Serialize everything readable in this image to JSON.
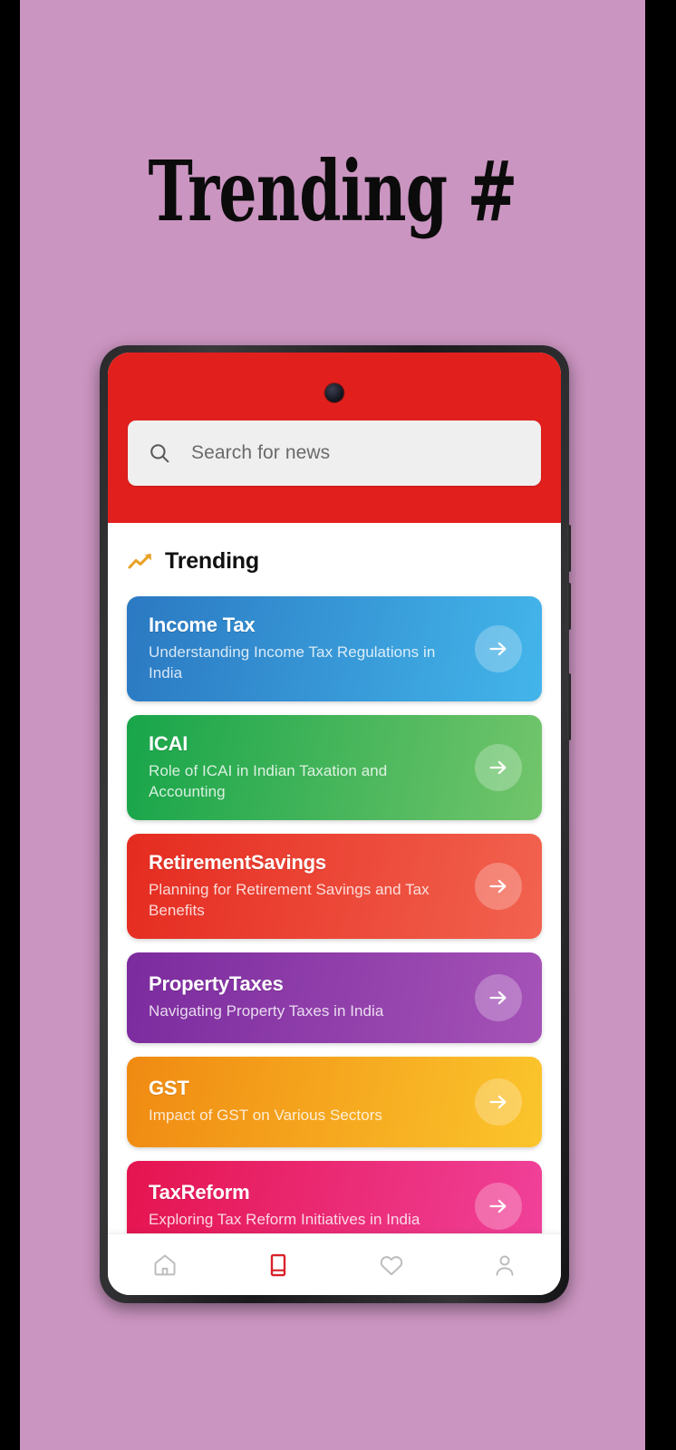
{
  "poster": {
    "title": "Trending #",
    "background_color": "#cb95c1",
    "letterbox_color": "#000000"
  },
  "app": {
    "header": {
      "background_color": "#e1201d",
      "search": {
        "placeholder": "Search for news",
        "icon": "search-icon",
        "value": ""
      },
      "camera": "camera-punch-hole"
    },
    "section": {
      "icon": "trending-up-icon",
      "title": "Trending"
    },
    "cards": [
      {
        "title": "Income Tax",
        "subtitle": "Understanding Income Tax Regulations in India",
        "color_start": "#2b79c2",
        "color_end": "#43b5ea",
        "arrow_icon": "arrow-right-icon"
      },
      {
        "title": "ICAI",
        "subtitle": "Role of ICAI in Indian Taxation and Accounting",
        "color_start": "#18a54a",
        "color_end": "#72c56b",
        "arrow_icon": "arrow-right-icon"
      },
      {
        "title": "RetirementSavings",
        "subtitle": "Planning for Retirement Savings and Tax Benefits",
        "color_start": "#e52b20",
        "color_end": "#f2634f",
        "arrow_icon": "arrow-right-icon"
      },
      {
        "title": "PropertyTaxes",
        "subtitle": "Navigating Property Taxes in India",
        "color_start": "#7b2b9e",
        "color_end": "#a553b7",
        "arrow_icon": "arrow-right-icon"
      },
      {
        "title": "GST",
        "subtitle": "Impact of GST on Various Sectors",
        "color_start": "#f08a12",
        "color_end": "#fbc52c",
        "arrow_icon": "arrow-right-icon"
      },
      {
        "title": "TaxReform",
        "subtitle": "Exploring Tax Reform Initiatives in India",
        "color_start": "#e5144f",
        "color_end": "#f0419a",
        "arrow_icon": "arrow-right-icon"
      }
    ],
    "bottom_nav": {
      "active_color": "#d8222a",
      "inactive_color": "#b9b9b9",
      "items": [
        {
          "name": "home",
          "icon": "home-icon",
          "active": false
        },
        {
          "name": "trending",
          "icon": "book-icon",
          "active": true
        },
        {
          "name": "favorites",
          "icon": "heart-icon",
          "active": false
        },
        {
          "name": "profile",
          "icon": "person-icon",
          "active": false
        }
      ]
    }
  }
}
